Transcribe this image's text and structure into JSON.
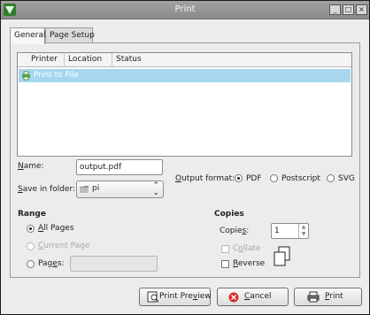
{
  "window": {
    "title": "Print",
    "controls": [
      "_",
      "□",
      "×"
    ]
  },
  "tabs": [
    {
      "label": "General",
      "active": true
    },
    {
      "label": "Page Setup",
      "active": false
    }
  ],
  "printer_list": {
    "columns": [
      "Printer",
      "Location",
      "Status"
    ],
    "rows": [
      {
        "printer": "Print to File",
        "location": "",
        "status": "",
        "selected": true
      }
    ]
  },
  "file": {
    "name_label": "Name:",
    "name_value": "output.pdf",
    "folder_label": "Save in folder:",
    "folder_value": "pi",
    "output_format_label": "Output format:",
    "formats": [
      {
        "label": "PDF",
        "selected": true
      },
      {
        "label": "Postscript",
        "selected": false
      },
      {
        "label": "SVG",
        "selected": false
      }
    ]
  },
  "range": {
    "heading": "Range",
    "options": [
      {
        "label": "All Pages",
        "selected": true,
        "enabled": true
      },
      {
        "label": "Current Page",
        "selected": false,
        "enabled": false
      },
      {
        "label": "Pages:",
        "selected": false,
        "enabled": true
      }
    ],
    "pages_value": ""
  },
  "copies": {
    "heading": "Copies",
    "copies_label": "Copies:",
    "copies_value": "1",
    "collate_label": "Collate",
    "collate_checked": false,
    "collate_enabled": false,
    "reverse_label": "Reverse",
    "reverse_checked": false
  },
  "buttons": {
    "preview": "Print Preview",
    "cancel": "Cancel",
    "print": "Print"
  },
  "colors": {
    "selection": "#a6d7ee",
    "cancel_icon": "#d62b2b"
  }
}
